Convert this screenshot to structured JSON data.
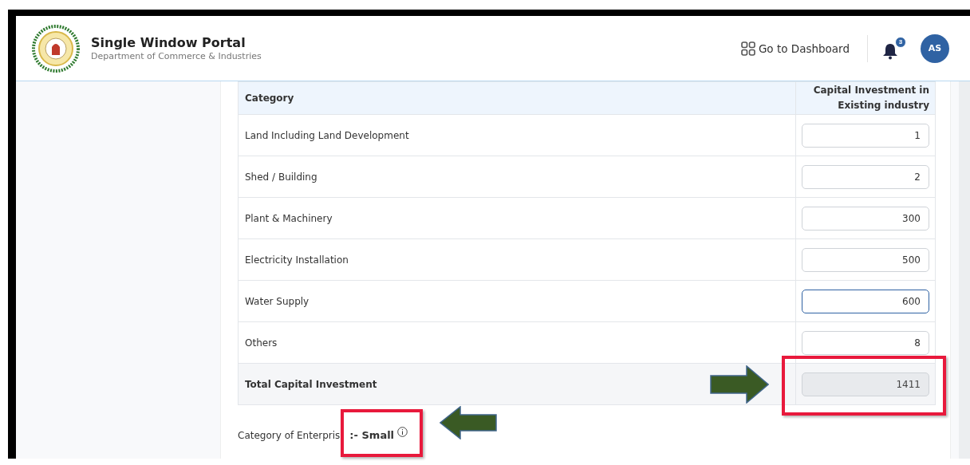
{
  "header": {
    "title": "Single Window Portal",
    "subtitle": "Department of Commerce & Industries",
    "dashboard_link": "Go to Dashboard",
    "notification_count": "3",
    "avatar": "AS"
  },
  "table": {
    "columns": [
      "Category",
      "Capital Investment in Existing industry"
    ],
    "rows": [
      {
        "label": "Land Including Land Development",
        "value": "1",
        "focused": false,
        "disabled": false,
        "total": false
      },
      {
        "label": "Shed / Building",
        "value": "2",
        "focused": false,
        "disabled": false,
        "total": false
      },
      {
        "label": "Plant & Machinery",
        "value": "300",
        "focused": false,
        "disabled": false,
        "total": false
      },
      {
        "label": "Electricity Installation",
        "value": "500",
        "focused": false,
        "disabled": false,
        "total": false
      },
      {
        "label": "Water Supply",
        "value": "600",
        "focused": true,
        "disabled": false,
        "total": false
      },
      {
        "label": "Others",
        "value": "8",
        "focused": false,
        "disabled": false,
        "total": false
      },
      {
        "label": "Total Capital Investment",
        "value": "1411",
        "focused": false,
        "disabled": true,
        "total": true
      }
    ]
  },
  "enterprise": {
    "label": "Category of Enterpris",
    "value": ":- Small"
  }
}
